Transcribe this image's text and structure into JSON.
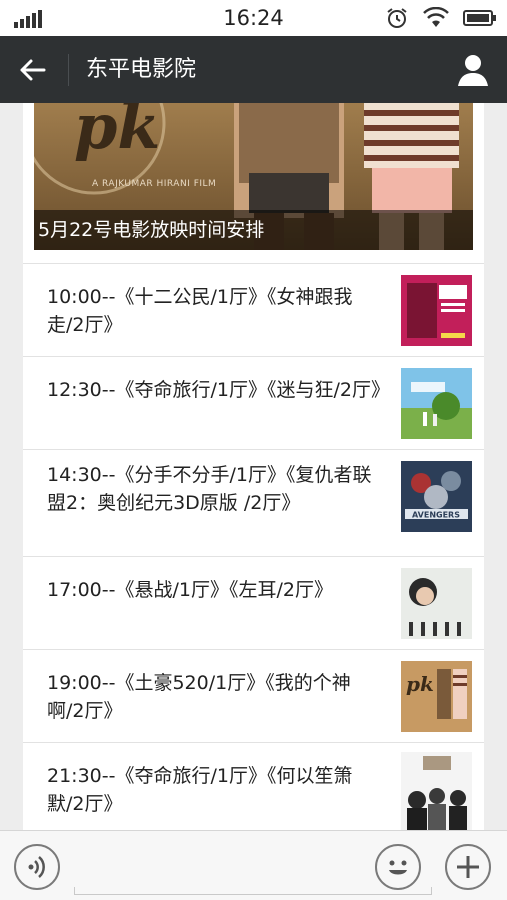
{
  "status_bar": {
    "time": "16:24"
  },
  "header": {
    "title": "东平电影院"
  },
  "banner": {
    "caption": "5月22号电影放映时间安排",
    "poster_title": "pk",
    "credit": "A RAJKUMAR HIRANI FILM"
  },
  "schedule": [
    {
      "text": "10:00--《十二公民/1厅》《女神跟我走/2厅》",
      "thumb_icon": "movie-poster-icon"
    },
    {
      "text": "12:30--《夺命旅行/1厅》《迷与狂/2厅》",
      "thumb_icon": "movie-poster-icon"
    },
    {
      "text": "14:30--《分手不分手/1厅》《复仇者联盟2：奥创纪元3D原版 /2厅》",
      "thumb_icon": "movie-poster-icon"
    },
    {
      "text": "17:00--《悬战/1厅》《左耳/2厅》",
      "thumb_icon": "movie-poster-icon"
    },
    {
      "text": "19:00--《土豪520/1厅》《我的个神啊/2厅》",
      "thumb_icon": "movie-poster-icon"
    },
    {
      "text": "21:30--《夺命旅行/1厅》《何以笙箫默/2厅》",
      "thumb_icon": "movie-poster-icon"
    }
  ],
  "input_bar": {
    "voice_icon": "voice-icon",
    "emoji_icon": "emoji-icon",
    "plus_icon": "plus-icon"
  },
  "colors": {
    "title_bar": "#2e3133",
    "background": "#ededed"
  }
}
